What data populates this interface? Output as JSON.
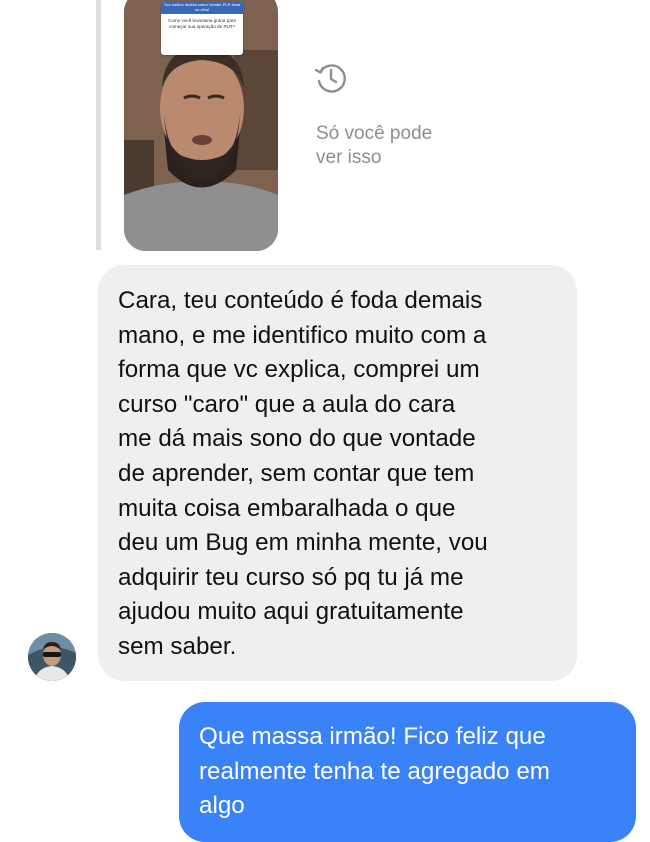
{
  "story_reply": {
    "sticker_header": "Tua melhor dúvida sobre Vender PLR fosta no olha!",
    "sticker_question": "Como você levantaria grana para começar sua operação de PLR?",
    "visibility_note": "Só você pode\nver isso",
    "icon": "history-icon"
  },
  "messages": [
    {
      "direction": "incoming",
      "text": "Cara, teu conteúdo é foda demais\nmano, e me identifico muito com a\nforma que vc explica, comprei um\ncurso \"caro\" que a aula do cara\nme dá mais sono do que vontade\nde aprender, sem contar que tem\nmuita coisa embaralhada o que\ndeu um Bug em minha mente, vou\nadquirir teu curso só pq tu já me\najudou muito aqui gratuitamente\nsem saber."
    },
    {
      "direction": "outgoing",
      "text": "Que massa irmão! Fico feliz que\nrealmente tenha te agregado em\nalgo"
    }
  ],
  "colors": {
    "incoming_bubble": "#efefef",
    "outgoing_bubble": "#3a82f7",
    "muted_text": "#8e8e8e"
  }
}
